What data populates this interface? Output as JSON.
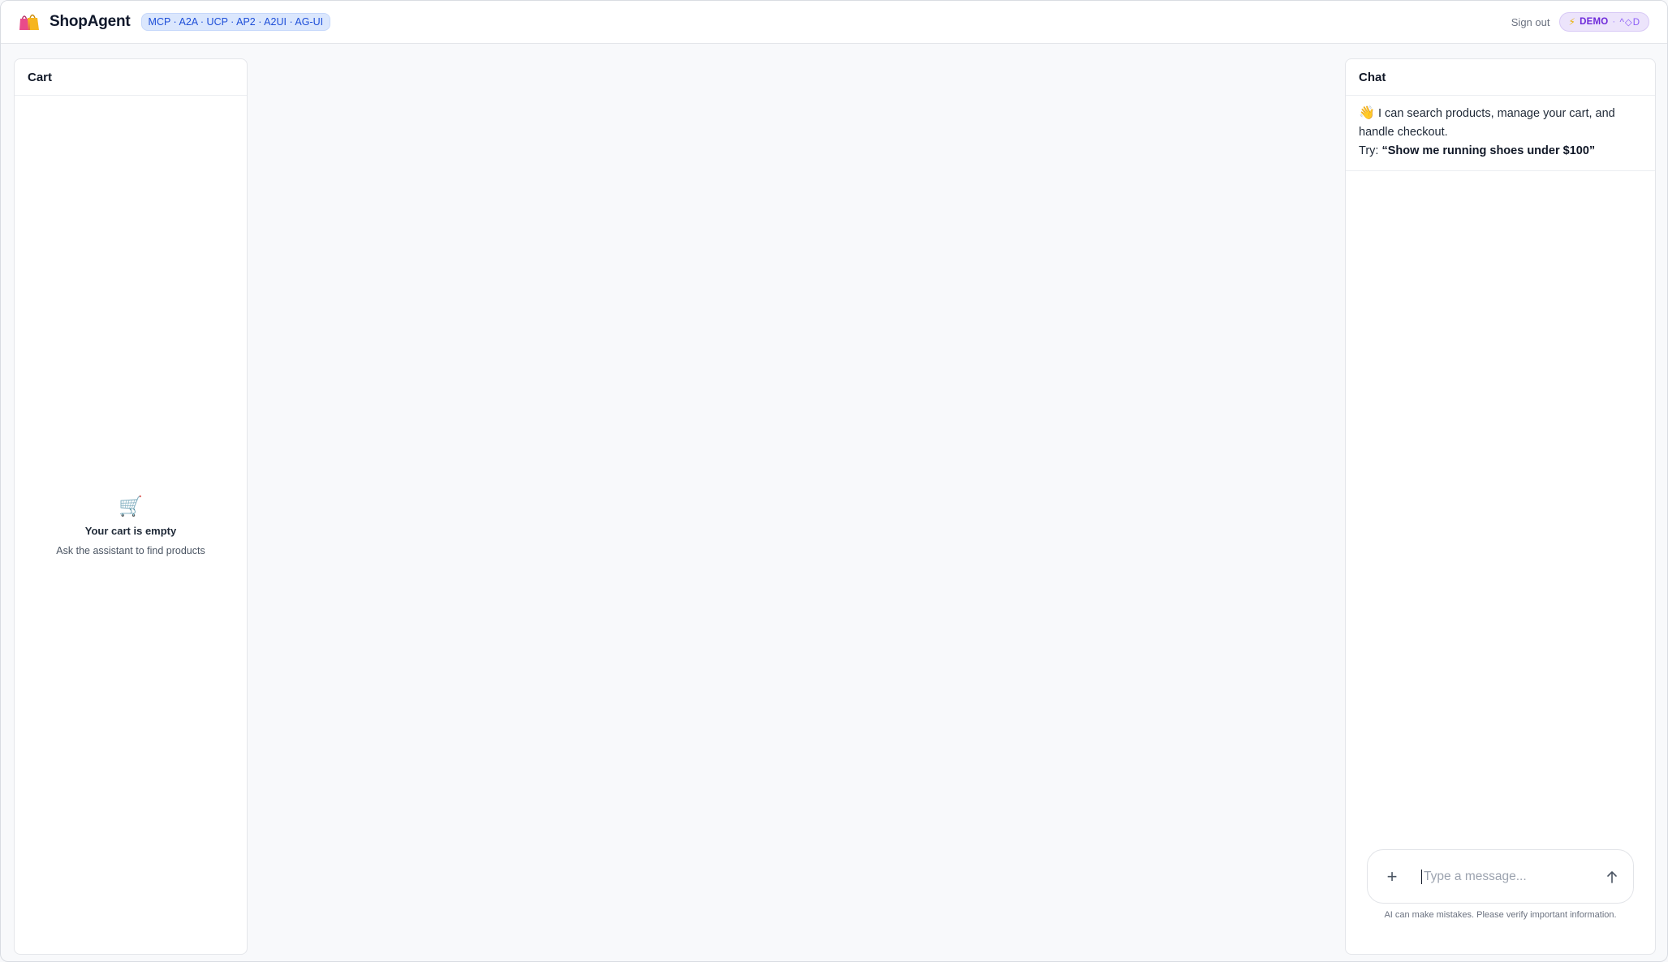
{
  "header": {
    "brand": "ShopAgent",
    "protocols_badge": "MCP · A2A · UCP · AP2 · A2UI · AG-UI",
    "sign_out": "Sign out",
    "demo_badge": {
      "label": "DEMO",
      "separator": "·",
      "extra": "^◇D"
    },
    "logo_icon": "shopping-bags-icon",
    "bolt_icon": "lightning-icon"
  },
  "cart": {
    "title": "Cart",
    "empty_icon": "shopping-cart-icon",
    "empty_title": "Your cart is empty",
    "empty_subtitle": "Ask the assistant to find products"
  },
  "chat": {
    "title": "Chat",
    "welcome": {
      "wave_icon": "waving-hand-icon",
      "line1": "I can search products, manage your cart, and handle checkout.",
      "try_prefix": "Try:",
      "try_example": "“Show me running shoes under $100”"
    },
    "input": {
      "placeholder": "Type a message...",
      "value": ""
    },
    "attach_icon": "plus-icon",
    "send_icon": "arrow-up-icon",
    "disclaimer": "AI can make mistakes. Please verify important information."
  },
  "colors": {
    "accent_blue": "#1d4ed8",
    "demo_purple": "#6d28d9",
    "background": "#f8f9fb"
  }
}
